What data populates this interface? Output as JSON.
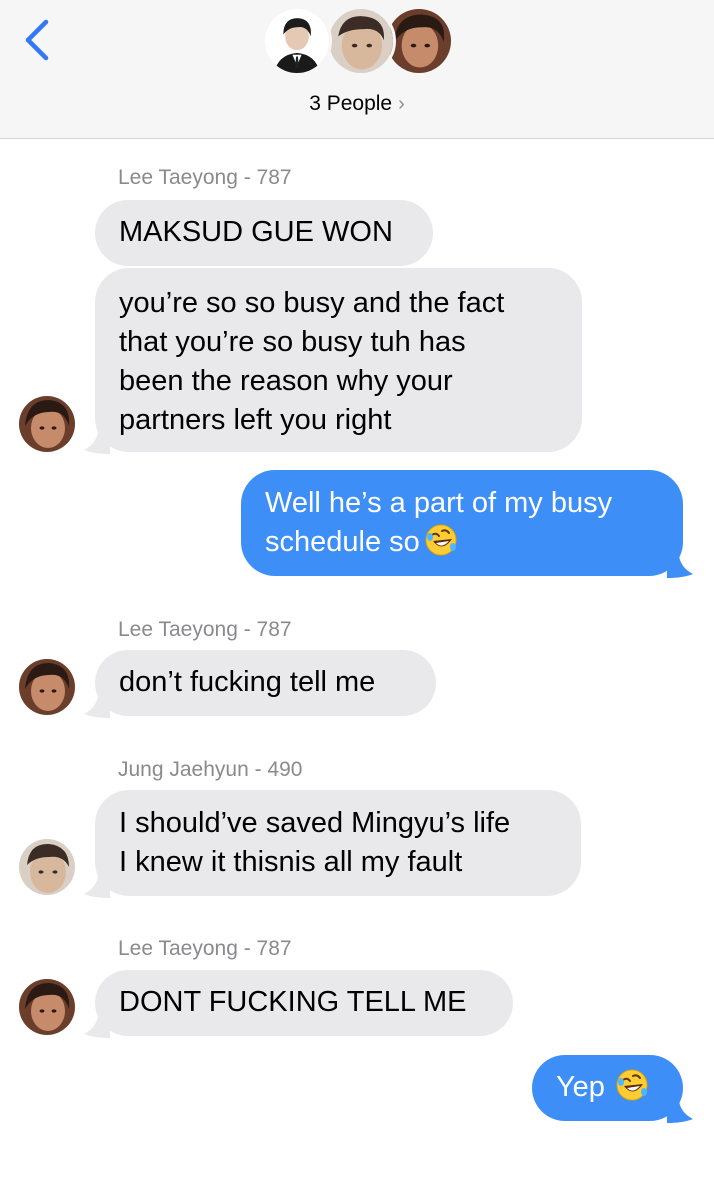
{
  "header": {
    "people_label": "3 People",
    "chevron": "›",
    "back_icon": "chevron-left-icon",
    "accent_color": "#3478f6"
  },
  "messages": [
    {
      "sender": "Lee Taeyong - 787",
      "lines": [
        "MAKSUD GUE WON"
      ],
      "direction": "incoming"
    },
    {
      "lines": [
        "you’re so so busy and the fact",
        "that you’re so busy tuh has",
        "been the reason why your",
        "partners left you right"
      ],
      "direction": "incoming"
    },
    {
      "lines": [
        "Well he’s a part of my busy",
        "schedule so"
      ],
      "direction": "outgoing",
      "emoji": "rolling-on-floor-laughing-emoji"
    },
    {
      "sender": "Lee Taeyong - 787",
      "lines": [
        "don’t fucking tell me"
      ],
      "direction": "incoming"
    },
    {
      "sender": "Jung Jaehyun - 490",
      "lines": [
        "I should’ve saved Mingyu’s life",
        "I knew it thisnis all my fault"
      ],
      "direction": "incoming"
    },
    {
      "sender": "Lee Taeyong - 787",
      "lines": [
        "DONT FUCKING TELL ME"
      ],
      "direction": "incoming"
    },
    {
      "lines": [
        "Yep"
      ],
      "direction": "outgoing",
      "emoji": "rolling-on-floor-laughing-emoji"
    }
  ],
  "colors": {
    "incoming_bubble": "#e9e9eb",
    "outgoing_bubble": "#3e8ef7",
    "sender_label": "#8a8a8e"
  }
}
